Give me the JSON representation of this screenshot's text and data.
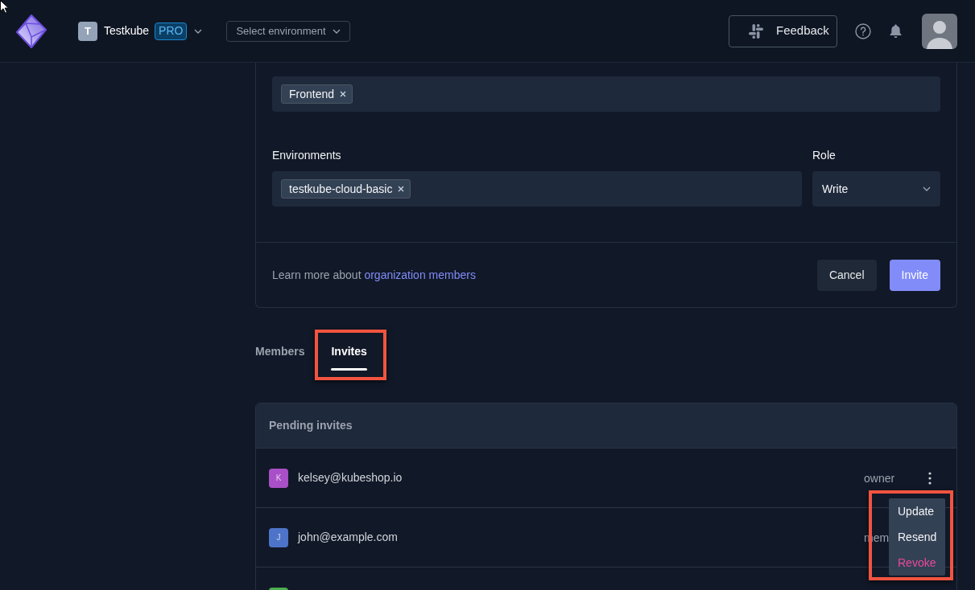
{
  "header": {
    "org": {
      "initial": "T",
      "name": "Testkube",
      "plan": "PRO"
    },
    "environment_select": {
      "placeholder": "Select environment"
    },
    "feedback_button": {
      "label": "Feedback"
    }
  },
  "invite_form": {
    "teams": {
      "tags": [
        "Frontend"
      ]
    },
    "environments": {
      "label": "Environments",
      "tags": [
        "testkube-cloud-basic"
      ]
    },
    "role": {
      "label": "Role",
      "value": "Write"
    },
    "help_text": "Learn more about",
    "help_link": "organization members",
    "buttons": [
      {
        "label": "Cancel",
        "kind": "secondary"
      },
      {
        "label": "Invite",
        "kind": "primary"
      }
    ]
  },
  "tabs": [
    {
      "label": "Members",
      "selected": false,
      "highlighted": false
    },
    {
      "label": "Invites",
      "selected": true,
      "highlighted": true
    }
  ],
  "pending_invites": {
    "title": "Pending invites",
    "invites": [
      {
        "initial": "K",
        "email": "kelsey@kubeshop.io",
        "role": "owner",
        "color": "#a94fc7",
        "menu": {
          "highlighted": true,
          "items": [
            {
              "label": "Update",
              "kind": "normal"
            },
            {
              "label": "Resend",
              "kind": "normal"
            },
            {
              "label": "Revoke",
              "kind": "danger"
            }
          ]
        }
      },
      {
        "initial": "J",
        "email": "john@example.com",
        "role": "mem",
        "color": "#4d74c8"
      },
      {
        "color": "#4caf50"
      }
    ]
  }
}
